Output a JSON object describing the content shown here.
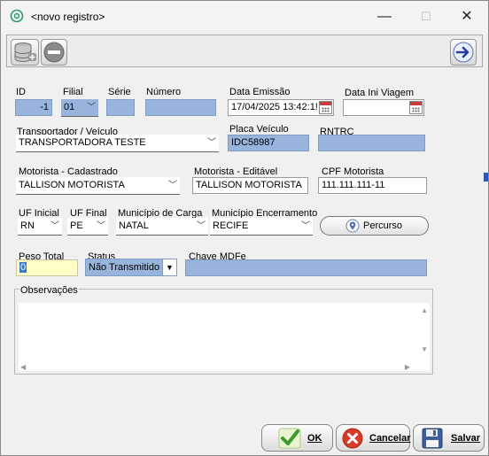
{
  "window": {
    "title": "<novo registro>",
    "minimize": "—",
    "maximize": "☐",
    "close": "✕"
  },
  "toolbar": {
    "add_icon": "database-add-icon",
    "remove_icon": "remove-icon",
    "next_icon": "arrow-right-icon"
  },
  "form": {
    "id": {
      "label": "ID",
      "value": "-1"
    },
    "filial": {
      "label": "Filial",
      "value": "01"
    },
    "serie": {
      "label": "Série",
      "value": ""
    },
    "numero": {
      "label": "Número",
      "value": ""
    },
    "data_emissao": {
      "label": "Data Emissão",
      "value": "17/04/2025 13:42:1!"
    },
    "data_ini_viagem": {
      "label": "Data Ini Viagem",
      "value": ""
    },
    "transportador": {
      "label": "Transportador / Veículo",
      "value": "TRANSPORTADORA TESTE"
    },
    "placa": {
      "label": "Placa Veículo",
      "value": "IDC58987"
    },
    "rntrc": {
      "label": "RNTRC",
      "value": ""
    },
    "motorista_cad": {
      "label": "Motorista - Cadastrado",
      "value": "TALLISON MOTORISTA"
    },
    "motorista_edit": {
      "label": "Motorista - Editável",
      "value": "TALLISON MOTORISTA"
    },
    "cpf": {
      "label": "CPF Motorista",
      "value": "111.111.111-11"
    },
    "uf_inicial": {
      "label": "UF Inicial",
      "value": "RN"
    },
    "uf_final": {
      "label": "UF Final",
      "value": "PE"
    },
    "mun_carga": {
      "label": "Município de Carga",
      "value": "NATAL"
    },
    "mun_enc": {
      "label": "Município Encerramento",
      "value": "RECIFE"
    },
    "percurso_button": "Percurso",
    "peso_total": {
      "label": "Peso Total",
      "value": "0"
    },
    "status": {
      "label": "Status",
      "value": "Não Transmitido"
    },
    "chave": {
      "label": "Chave MDFe",
      "value": ""
    },
    "observacoes": {
      "label": "Observações",
      "value": ""
    }
  },
  "footer": {
    "ok": "OK",
    "cancelar": "Cancelar",
    "salvar": "Salvar"
  }
}
